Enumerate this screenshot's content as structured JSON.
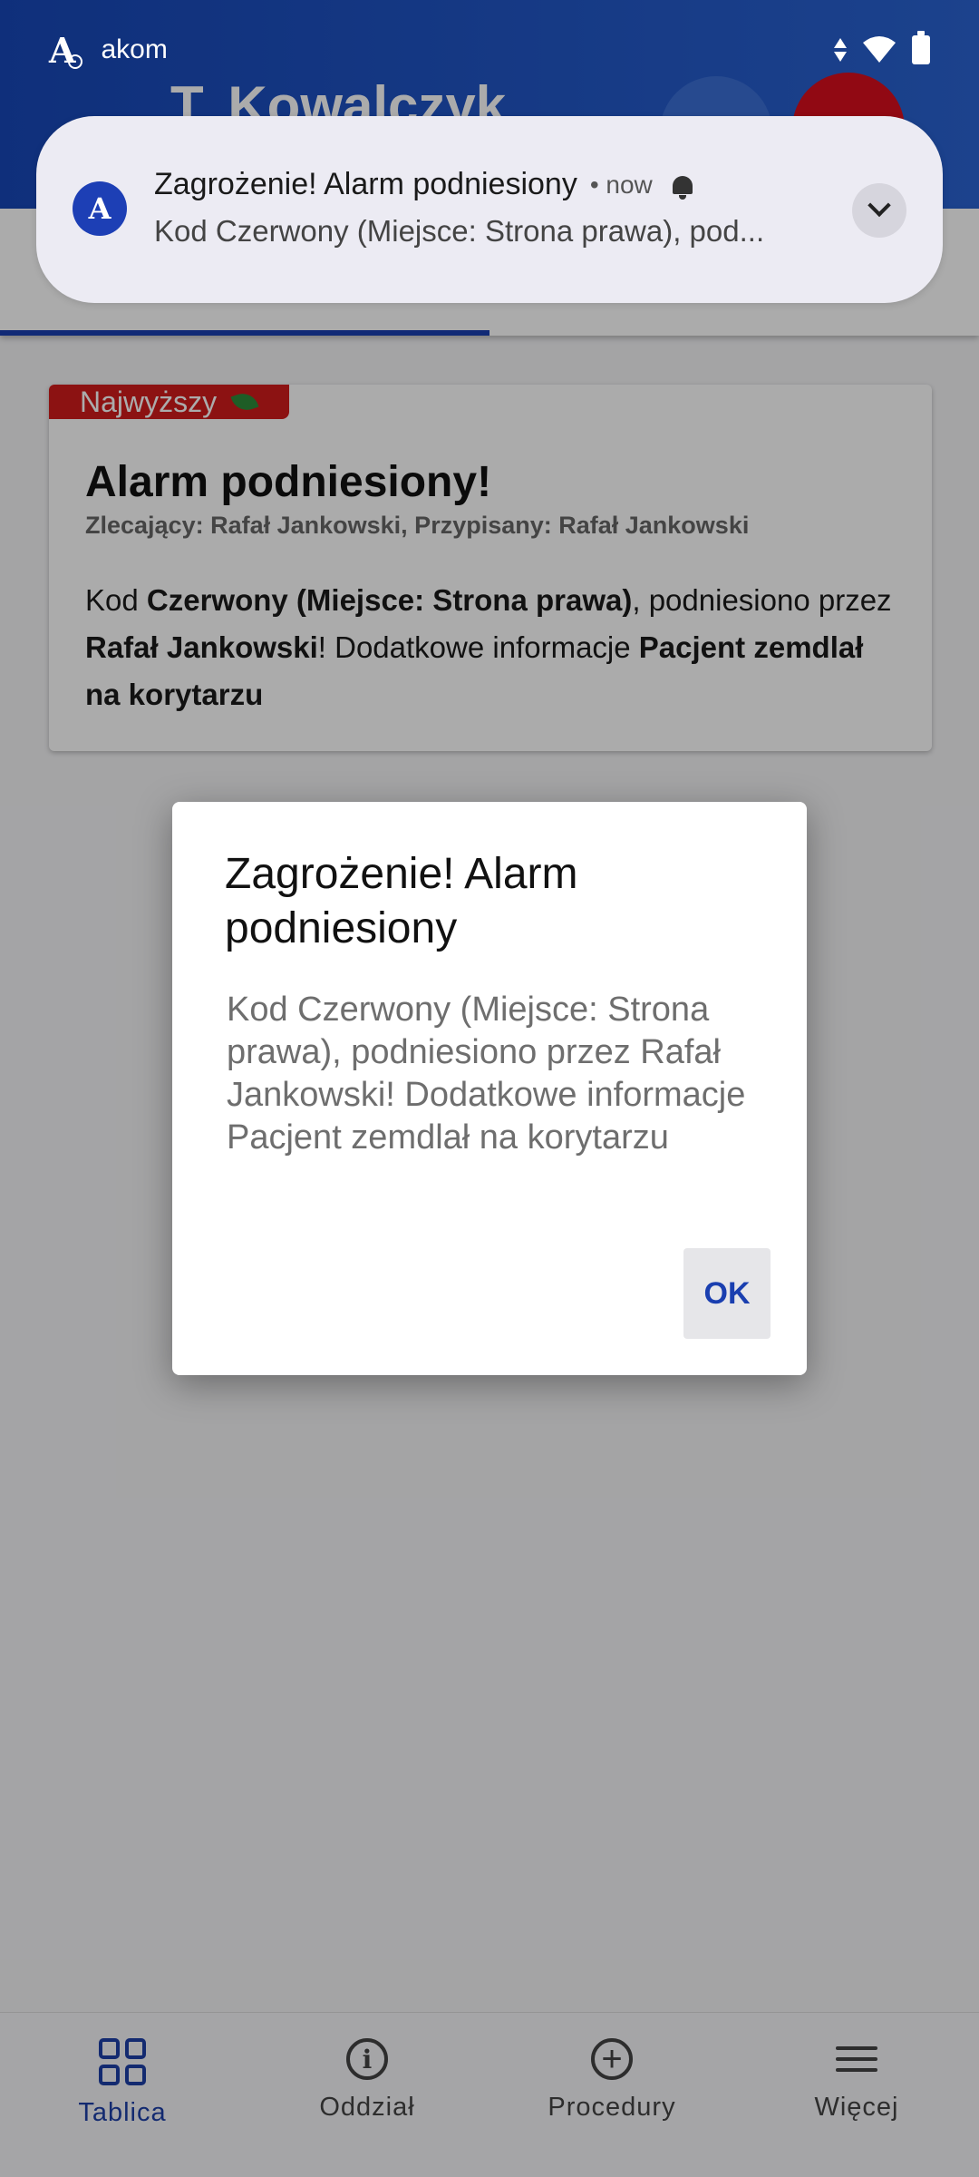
{
  "status_bar": {
    "app_logo": "A",
    "app_name": "akom"
  },
  "header": {
    "title": "T. Kowalczyk"
  },
  "notification": {
    "avatar": "A",
    "title": "Zagrożenie! Alarm podniesiony",
    "time": "• now",
    "text": "Kod Czerwony (Miejsce: Strona prawa), pod..."
  },
  "task_card": {
    "priority": "Najwyższy",
    "title": "Alarm podniesiony!",
    "meta": "Zlecający: Rafał Jankowski,  Przypisany: Rafał Jankowski",
    "body": {
      "t1": "Kod ",
      "b1": "Czerwony (Miejsce: Strona prawa)",
      "t2": ", podniesiono przez ",
      "b2": "Rafał Jankowski",
      "t3": "! Dodatkowe informacje ",
      "b3": "Pacjent zemdlał na korytarzu"
    }
  },
  "dialog": {
    "title": "Zagrożenie! Alarm podniesiony",
    "message": "Kod Czerwony (Miejsce: Strona prawa), podniesiono przez Rafał Jankowski! Dodatkowe informacje Pacjent zemdlał na korytarzu",
    "ok_label": "OK"
  },
  "bottom_nav": {
    "items": [
      {
        "label": "Tablica",
        "icon": "grid-icon",
        "active": true
      },
      {
        "label": "Oddział",
        "icon": "info-icon",
        "active": false
      },
      {
        "label": "Procedury",
        "icon": "add-circle-icon",
        "active": false
      },
      {
        "label": "Więcej",
        "icon": "menu-icon",
        "active": false
      }
    ]
  },
  "colors": {
    "header": "#1747b8",
    "accent": "#1a3fb0",
    "priority": "#d11b1b",
    "notification_bg": "#ecebf3"
  }
}
